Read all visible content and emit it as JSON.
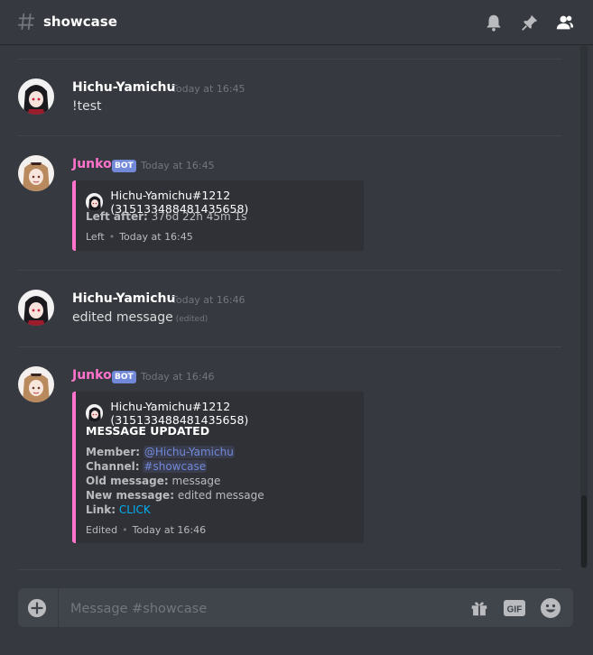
{
  "header": {
    "channel_name": "showcase",
    "icons": [
      "hash-icon",
      "bell-icon",
      "pin-icon",
      "members-icon"
    ]
  },
  "messages": [
    {
      "author": "Hichu-Yamichu",
      "timestamp": "Today at 16:45",
      "content": "!test"
    },
    {
      "author": "Junko",
      "bot_tag": "BOT",
      "timestamp": "Today at 16:45",
      "embed": {
        "author": "Hichu-Yamichu#1212 (315133488481435658)",
        "left_after_label": "Left after:",
        "left_after_value": "376d 22h 45m 1s",
        "footer_text": "Left",
        "footer_time": "Today at 16:45"
      }
    },
    {
      "author": "Hichu-Yamichu",
      "timestamp": "Today at 16:46",
      "content": "edited message",
      "edited_label": "(edited)"
    },
    {
      "author": "Junko",
      "bot_tag": "BOT",
      "timestamp": "Today at 16:46",
      "embed": {
        "author": "Hichu-Yamichu#1212 (315133488481435658)",
        "title": "MESSAGE UPDATED",
        "member_label": "Member:",
        "member_value": "@Hichu-Yamichu",
        "channel_label": "Channel:",
        "channel_value": "#showcase",
        "old_label": "Old message:",
        "old_value": "message",
        "new_label": "New message:",
        "new_value": "edited message",
        "link_label": "Link:",
        "link_value": "CLICK",
        "footer_text": "Edited",
        "footer_time": "Today at 16:46"
      }
    }
  ],
  "composer": {
    "placeholder": "Message #showcase",
    "gif_label": "GIF"
  },
  "colors": {
    "background": "#36393f",
    "embed_background": "#2f3136",
    "bot_name": "#ff73cc",
    "bot_tag": "#7289da",
    "link": "#00b0f4",
    "mention": "#7289da"
  }
}
